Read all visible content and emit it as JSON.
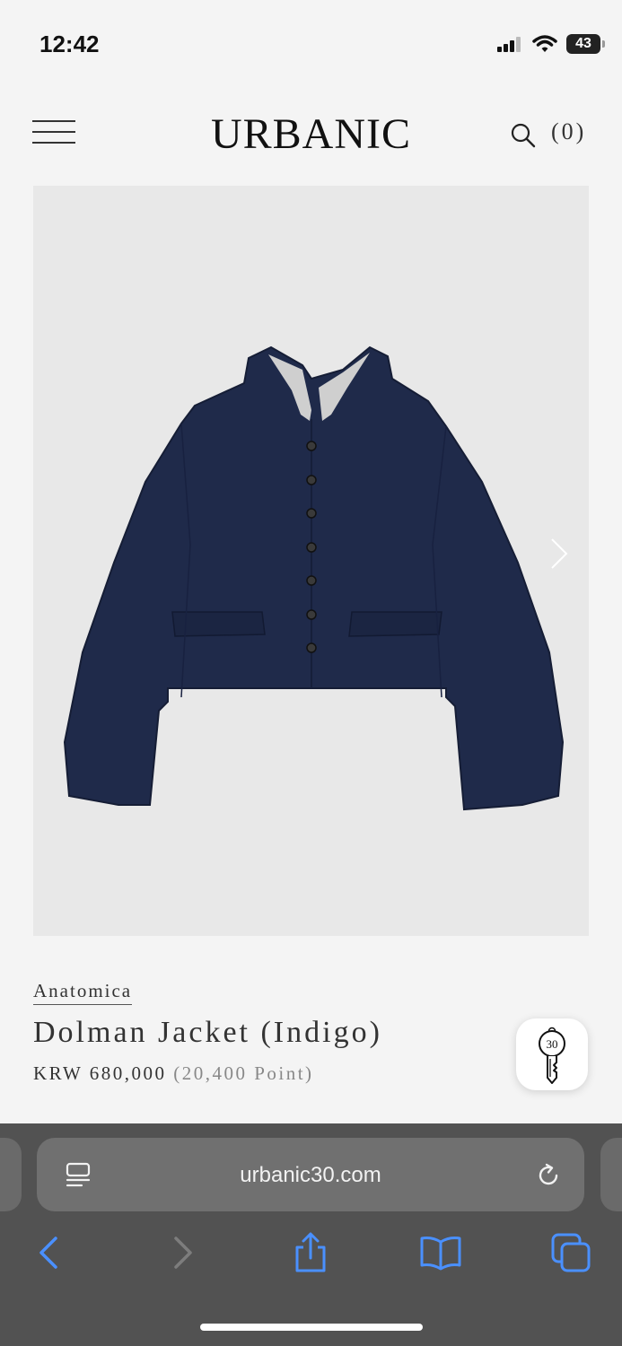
{
  "status": {
    "time": "12:42",
    "battery": "43"
  },
  "header": {
    "logo": "URBANIC",
    "cart_count": "(0)"
  },
  "product": {
    "brand": "Anatomica",
    "name": "Dolman Jacket (Indigo)",
    "price": "KRW 680,000",
    "points": "(20,400 Point)",
    "image_label": "indigo denim jacket"
  },
  "floating_badge": {
    "number": "30"
  },
  "browser": {
    "url": "urbanic30.com"
  },
  "colors": {
    "denim": "#1f2a4a",
    "background": "#f4f4f4",
    "image_bg": "#e8e8e8",
    "ios_blue": "#4a90ff",
    "chrome_bg": "#525252"
  }
}
